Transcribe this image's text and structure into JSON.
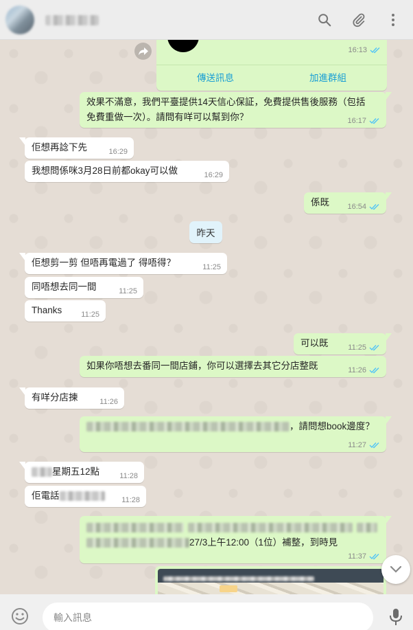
{
  "header": {
    "contact_name": "",
    "icons": [
      "search-icon",
      "attach-icon",
      "menu-icon"
    ]
  },
  "card": {
    "time": "16:13",
    "btn_send": "傳送訊息",
    "btn_join": "加進群組"
  },
  "messages": {
    "m1": {
      "text1": "效果不滿意，我們平臺提供14天信心保証，免費提供售後服務（包括",
      "text2": "免費重做一次）。請問有咩可以幫到你？",
      "time": "16:17"
    },
    "m2": {
      "text": "佢想再諗下先",
      "time": "16:29"
    },
    "m3": {
      "text": "我想問係咪3月28日前都okay可以做",
      "time": "16:29"
    },
    "m4": {
      "text": "係既",
      "time": "16:54"
    },
    "m5": {
      "text": "佢想剪一剪 但唔再電過了 得唔得？",
      "time": "11:25"
    },
    "m6": {
      "text": "同唔想去同一間",
      "time": "11:25"
    },
    "m7": {
      "text": "Thanks",
      "time": "11:25"
    },
    "m8": {
      "text": "可以既",
      "time": "11:25"
    },
    "m9": {
      "text": "如果你唔想去番同一間店鋪，你可以選擇去其它分店整既",
      "time": "11:26"
    },
    "m10": {
      "text": "有咩分店揀",
      "time": "11:26"
    },
    "m11": {
      "text": "，請問想book邊度？",
      "time": "11:27"
    },
    "m12": {
      "text": "星期五12點",
      "time": "11:28"
    },
    "m13": {
      "text": "佢電話",
      "time": "11:28"
    },
    "m14": {
      "text": "27/3上午12:00（1位）補整，到時見",
      "time": "11:37"
    }
  },
  "date_divider": "昨天",
  "map_preview": {
    "caption": ""
  },
  "composer": {
    "placeholder": "輸入訊息"
  },
  "colors": {
    "outgoing": "#dcf8c6",
    "incoming": "#ffffff",
    "tick_blue": "#4fc3f7",
    "link": "#1a9fd4"
  }
}
